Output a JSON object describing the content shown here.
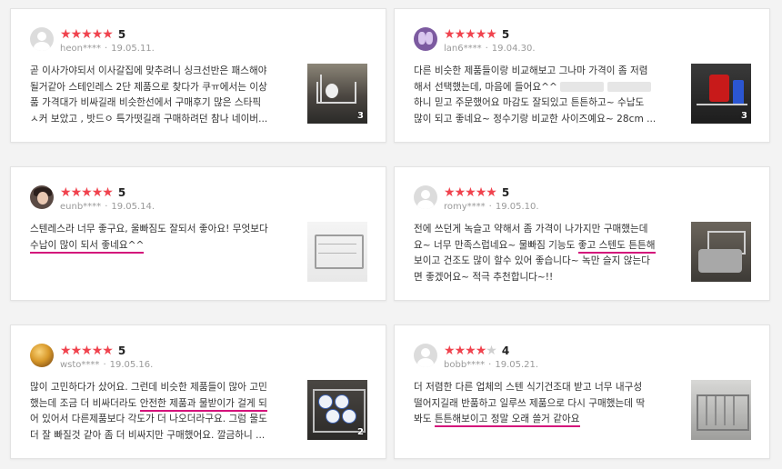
{
  "reviews": [
    {
      "user": "heon****",
      "date": "19.05.11.",
      "rating_value": 5,
      "score": "5",
      "avatar": "default-avatar-icon",
      "lines": [
        "곧 이사가야되서 이사갈집에 맞추려니 싱크선반은 패스해야",
        "될거같아 스테인레스 2단 제품으로 찾다가 쿠ㅠ에서는 이상",
        "품 가격대가 비싸길래 비슷한선에서 구매후기 많은 스타픽",
        "ㅅ커 보았고 , 밧드ㅇ 특가떳길래 구매하려던 참나 네이버..."
      ],
      "photo_count": "3"
    },
    {
      "user": "lan6****",
      "date": "19.04.30.",
      "rating_value": 5,
      "score": "5",
      "avatar": "purple-avatar",
      "lines": [
        "다른 비슷한 제품들이랑 비교해보고 그나마 가격이 좀 저렴",
        "해서 선택했는데, 마음에 들어요^^",
        "하니 믿고 주문했어요 마감도 잘되있고 튼튼하고~ 수납도",
        "많이 되고 좋네요~ 정수기랑 비교한 사이즈예요~ 28cm ..."
      ],
      "photo_count": "3"
    },
    {
      "user": "eunb****",
      "date": "19.05.14.",
      "rating_value": 5,
      "score": "5",
      "avatar": "girl-avatar",
      "lines": [
        "스텐레스라 너무 좋구요, 울빠짐도 잘되서 좋아요! 무엇보다",
        "수납이 많이 되서 좋네요^^"
      ],
      "photo_count": ""
    },
    {
      "user": "romy****",
      "date": "19.05.10.",
      "rating_value": 5,
      "score": "5",
      "avatar": "default-avatar-icon",
      "lines": [
        "전에 쓰던게 녹슬고 약해서 좀 가격이 나가지만 구매했는데",
        "요~ 너무 만족스럽네요~ 물빠짐 기능도 좋고 스텐도 튼튼해",
        "보이고 건조도 많이 할수 있어 좋습니다~ 녹만 슬지 않는다",
        "면 좋겠어요~ 적극 추천합니다~!!"
      ],
      "photo_count": ""
    },
    {
      "user": "wsto****",
      "date": "19.05.16.",
      "rating_value": 5,
      "score": "5",
      "avatar": "gold-avatar",
      "lines": [
        "많이 고민하다가 샀어요. 그런데 비슷한 제품들이 많아 고민",
        "했는데 조금 더 비싸더라도 안전한 제품과 물받이가 걸게 되",
        "어 있어서 다른제품보다 각도가 더 나오더라구요. 그럼 물도",
        "더 잘 빠질것 같아 좀 더 비싸지만 구매했어요. 깔금하니 ..."
      ],
      "photo_count": "2"
    },
    {
      "user": "bobb****",
      "date": "19.05.21.",
      "rating_value": 4,
      "score": "4",
      "avatar": "default-avatar-icon",
      "lines": [
        "더 저렴한 다른 업체의 스텐 식기건조대 받고 너무 내구성",
        "떨어지길래 반품하고 일루쓰 제품으로 다시 구매했는데 딱",
        "봐도 튼튼해보이고 정말 오래 쓸거 같아요"
      ],
      "photo_count": ""
    }
  ],
  "ui": {
    "star_glyph": "★",
    "dot": "·",
    "accent_color": "#f0434e",
    "underline_color": "#d4127b"
  }
}
